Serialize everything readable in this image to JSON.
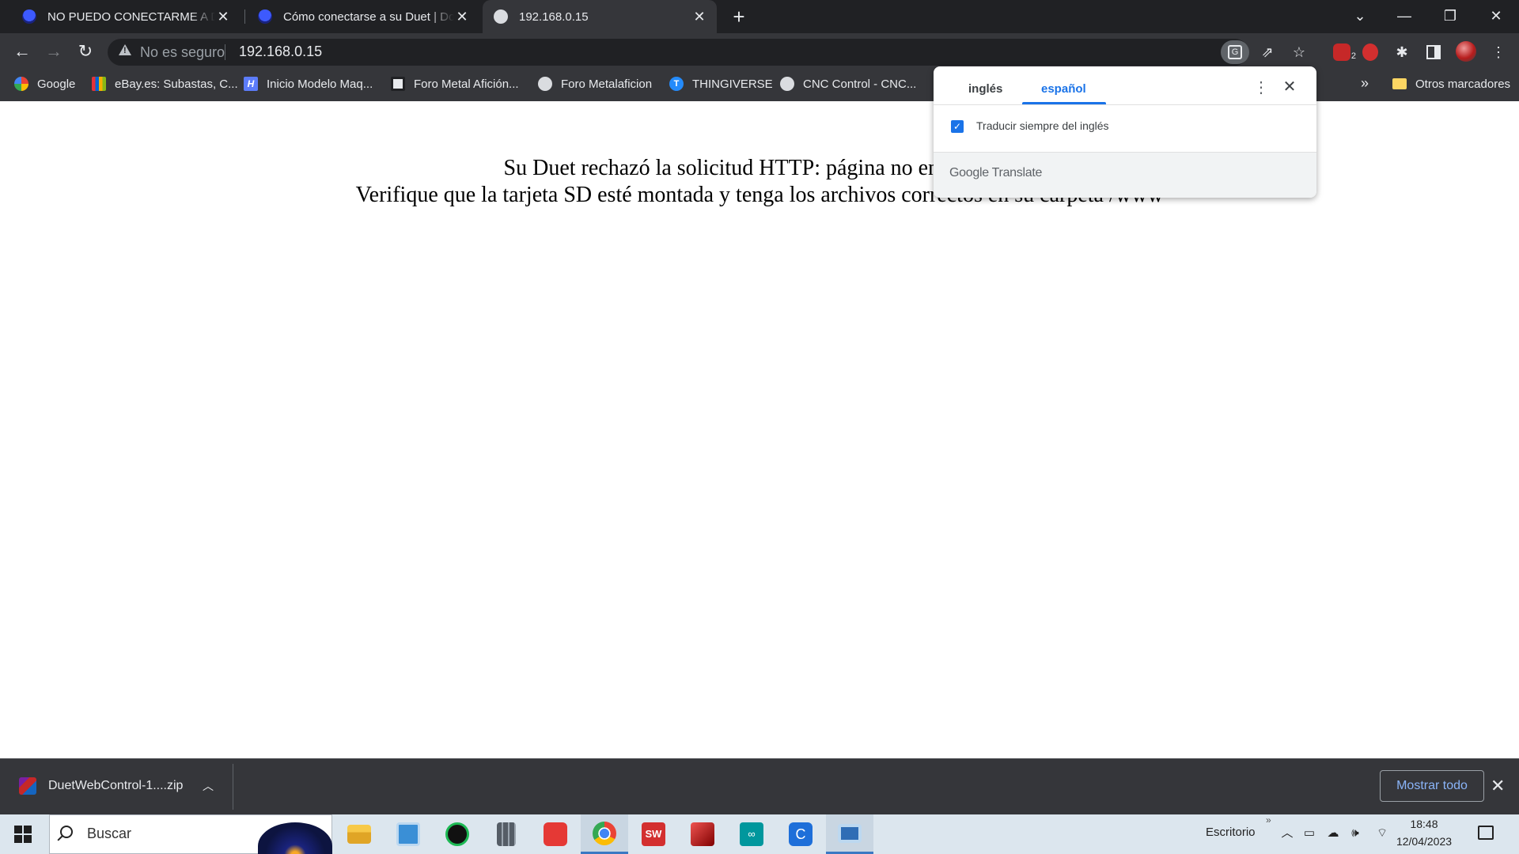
{
  "browser": {
    "tabs": [
      {
        "title": "NO PUEDO CONECTARME A DUET",
        "active": false
      },
      {
        "title": "Cómo conectarse a su Duet | Documentación",
        "active": false
      },
      {
        "title": "192.168.0.15",
        "active": true
      }
    ],
    "new_tab_label": "+",
    "window_controls": {
      "tab_search": "⌄",
      "minimize": "—",
      "restore": "❐",
      "close": "✕"
    }
  },
  "toolbar": {
    "security_label": "No es seguro",
    "url": "192.168.0.15",
    "extension_badge": "2"
  },
  "bookmarks": {
    "items": [
      {
        "label": "Google",
        "icon": "google-icon",
        "color": "#4285f4"
      },
      {
        "label": "eBay.es: Subastas, C...",
        "icon": "ebay-icon",
        "color": "#f5af02"
      },
      {
        "label": "Inicio Modelo Maq...",
        "icon": "h-icon",
        "color": "#5c7cfa"
      },
      {
        "label": "Foro Metal Afición...",
        "icon": "forum-icon",
        "color": "#e8eaed"
      },
      {
        "label": "Foro Metalaficion",
        "icon": "globe-icon",
        "color": "#dadce0"
      },
      {
        "label": "THINGIVERSE",
        "icon": "thingiverse-icon",
        "color": "#248bfb"
      },
      {
        "label": "CNC Control - CNC...",
        "icon": "globe-icon",
        "color": "#dadce0"
      }
    ],
    "more_label": "»",
    "other_bookmarks": "Otros marcadores"
  },
  "page": {
    "line1": "Su Duet rechazó la solicitud HTTP: página no encontrada",
    "line2": "Verifique que la tarjeta SD esté montada y tenga los archivos correctos en su carpeta /www"
  },
  "translate_bubble": {
    "source_lang": "inglés",
    "target_lang": "español",
    "always_translate_label": "Traducir siempre del inglés",
    "always_translate_checked": true,
    "brand_google": "Google",
    "brand_translate": "Translate",
    "accent_color": "#1a73e8"
  },
  "download_shelf": {
    "file_name": "DuetWebControl-1....zip",
    "show_all_label": "Mostrar todo"
  },
  "taskbar": {
    "search_placeholder": "Buscar",
    "desktop_label": "Escritorio",
    "time": "18:48",
    "date": "12/04/2023",
    "apps": [
      {
        "name": "file-explorer-icon",
        "color": "#f2b632"
      },
      {
        "name": "control-panel-icon",
        "color": "#3a8fd6"
      },
      {
        "name": "spotify-icon",
        "color": "#1db954"
      },
      {
        "name": "calculator-icon",
        "color": "#555d66"
      },
      {
        "name": "red-app-icon",
        "color": "#e53935"
      },
      {
        "name": "chrome-icon",
        "color": "#4285f4"
      },
      {
        "name": "solidworks-icon",
        "color": "#d32f2f"
      },
      {
        "name": "red-box-app-icon",
        "color": "#b71c1c"
      },
      {
        "name": "arduino-icon",
        "color": "#00979d"
      },
      {
        "name": "c-app-icon",
        "color": "#1e6fd9"
      },
      {
        "name": "remote-desktop-icon",
        "color": "#2f6db5"
      }
    ]
  }
}
